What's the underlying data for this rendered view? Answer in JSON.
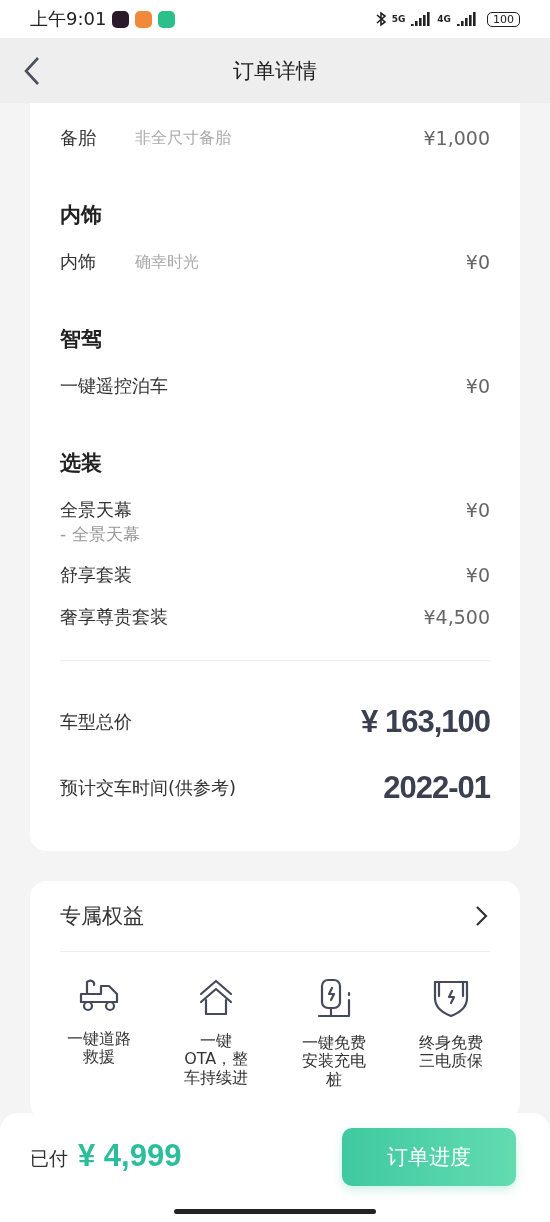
{
  "status_bar": {
    "time": "上午9:01",
    "network": [
      "5G",
      "4G"
    ],
    "battery": "100"
  },
  "nav": {
    "title": "订单详情"
  },
  "sections": [
    {
      "items": [
        {
          "label": "备胎",
          "spec": "非全尺寸备胎",
          "price": "¥1,000"
        }
      ]
    },
    {
      "heading": "内饰",
      "items": [
        {
          "label": "内饰",
          "spec": "确幸时光",
          "price": "¥0"
        }
      ]
    },
    {
      "heading": "智驾",
      "items": [
        {
          "label": "一键遥控泊车",
          "price": "¥0"
        }
      ]
    },
    {
      "heading": "选装",
      "items": [
        {
          "label": "全景天幕",
          "price": "¥0",
          "sub": "-  全景天幕"
        },
        {
          "label": "舒享套装",
          "price": "¥0"
        },
        {
          "label": "奢享尊贵套装",
          "price": "¥4,500"
        }
      ]
    }
  ],
  "totals": [
    {
      "label": "车型总价",
      "value": "¥ 163,100"
    },
    {
      "label": "预计交车时间(供参考)",
      "value": "2022-01"
    }
  ],
  "benefits": {
    "title": "专属权益",
    "items": [
      {
        "kind": "tow",
        "label": "一键道路救援"
      },
      {
        "kind": "ota",
        "label": "一键OTA，整车持续进"
      },
      {
        "kind": "charger",
        "label": "一键免费安装充电桩"
      },
      {
        "kind": "shield",
        "label": "终身免费三电质保"
      }
    ]
  },
  "footer": {
    "paid_label": "已付",
    "paid_amount": "¥ 4,999",
    "button": "订单进度"
  }
}
